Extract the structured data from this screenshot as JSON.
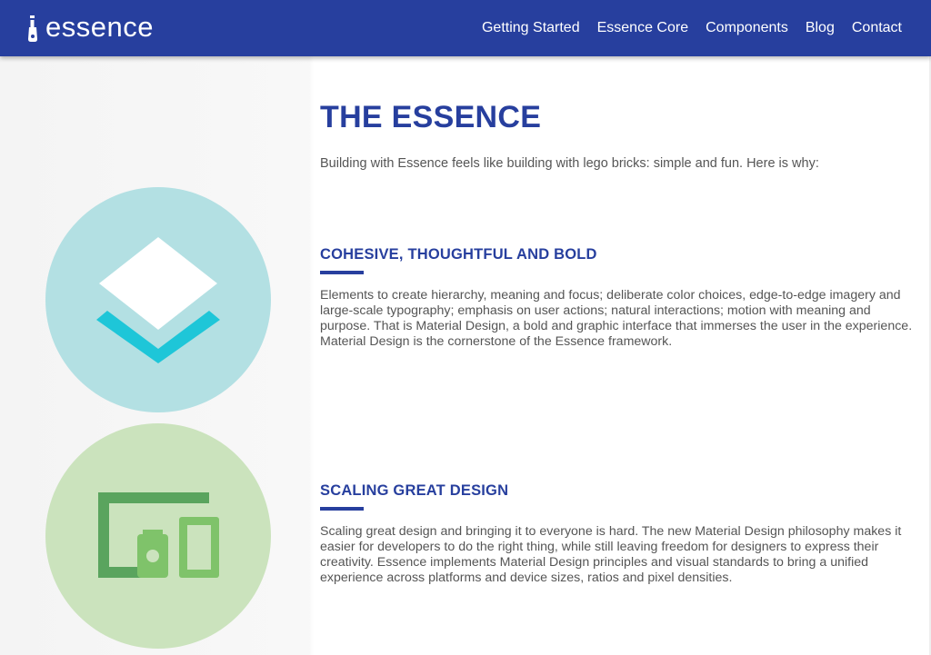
{
  "brand": {
    "name": "essence"
  },
  "nav": {
    "items": [
      {
        "label": "Getting Started"
      },
      {
        "label": "Essence Core"
      },
      {
        "label": "Components"
      },
      {
        "label": "Blog"
      },
      {
        "label": "Contact"
      }
    ]
  },
  "main": {
    "title": "THE ESSENCE",
    "intro": "Building with Essence feels like building with lego bricks: simple and fun. Here is why:",
    "features": [
      {
        "heading": "COHESIVE, THOUGHTFUL AND BOLD",
        "text": "Elements to create hierarchy, meaning and focus; deliberate color choices, edge-to-edge imagery and large-scale typography; emphasis on user actions; natural interactions; motion with meaning and purpose. That is Material Design, a bold and graphic interface that immerses the user in the experience. Material Design is the cornerstone of the Essence framework.",
        "icon": "layers-icon",
        "circle_color": "#b3e0e3"
      },
      {
        "heading": "SCALING GREAT DESIGN",
        "text": "Scaling great design and bringing it to everyone is hard. The new Material Design philosophy makes it easier for developers to do the right thing, while still leaving freedom for designers to express their creativity. Essence implements Material Design principles and visual standards to bring a unified experience across platforms and device sizes, ratios and pixel densities.",
        "icon": "devices-icon",
        "circle_color": "#cbe3bd"
      }
    ]
  },
  "colors": {
    "navbar": "#273f9e",
    "accent": "#273f9e",
    "layers_diamond": "#ffffff",
    "layers_chevron": "#1ec6d8",
    "devices_dark": "#5aa45e",
    "devices_light": "#7fc36a"
  }
}
